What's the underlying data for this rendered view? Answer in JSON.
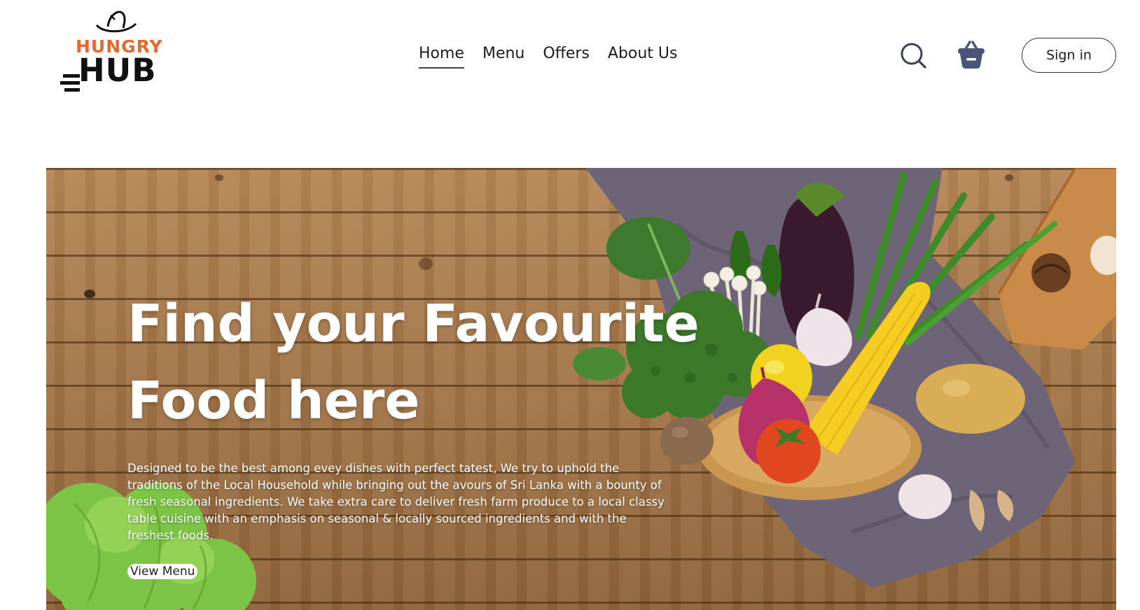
{
  "brand": {
    "name_top": "HUNGRY",
    "name_bottom": "HUB",
    "accent_color": "#e8692c"
  },
  "nav": {
    "items": [
      {
        "label": "Home",
        "active": true
      },
      {
        "label": "Menu",
        "active": false
      },
      {
        "label": "Offers",
        "active": false
      },
      {
        "label": "About Us",
        "active": false
      }
    ]
  },
  "header_actions": {
    "search_icon": "search-icon",
    "cart_icon": "basket-icon",
    "cart_color": "#4a5478",
    "signin_label": "Sign in"
  },
  "hero": {
    "title": "Find your Favourite Food here",
    "description": "Designed to be the best among evey dishes with perfect tatest, We try to uphold the traditions of the Local Household while bringing out the avours of Sri Lanka with a bounty of fresh seasonal ingredients. We take extra care to deliver fresh farm produce to a local classy table cuisine with an emphasis on seasonal & locally sourced ingredients and with the freshest foods.",
    "cta_label": "View Menu"
  }
}
